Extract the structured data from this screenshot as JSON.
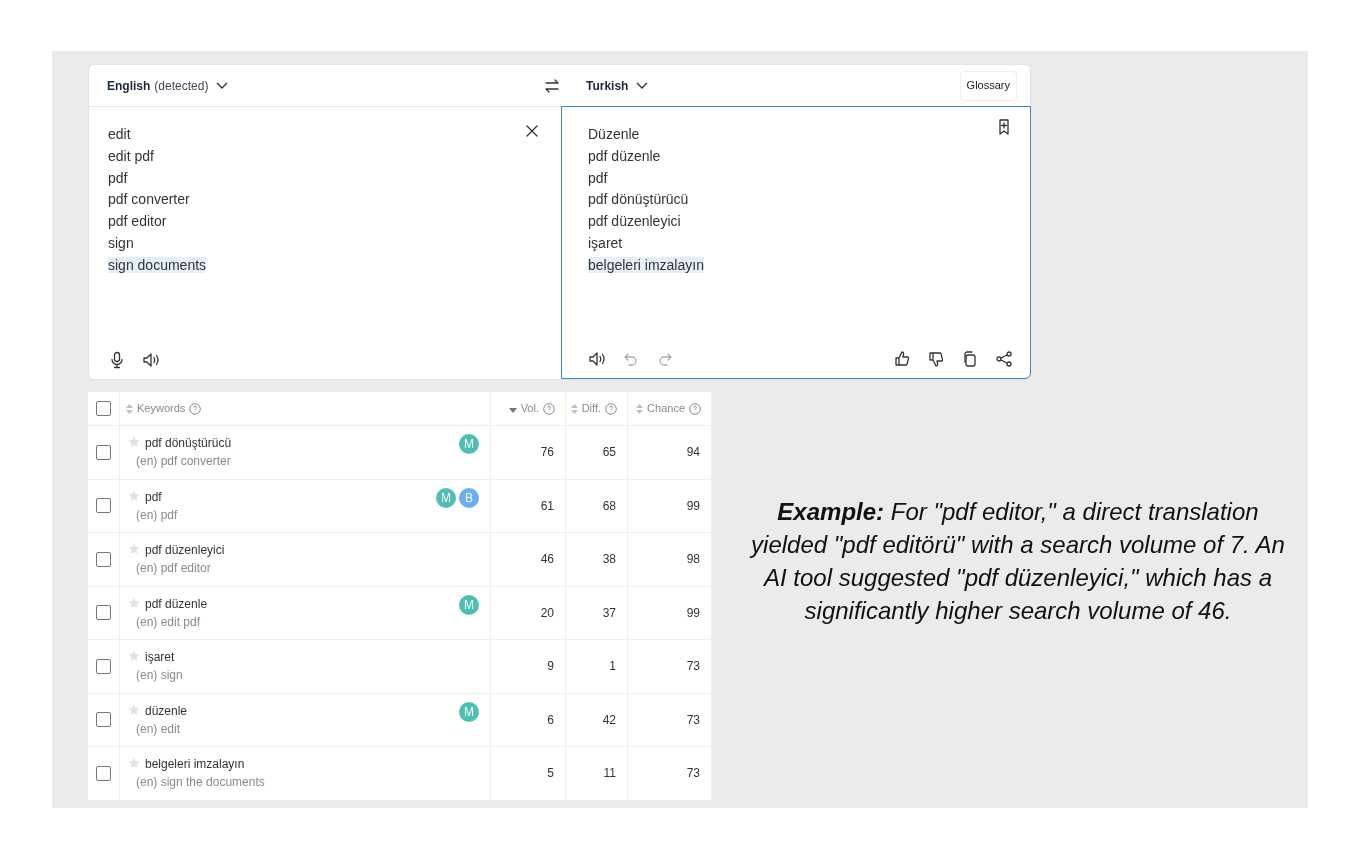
{
  "translator": {
    "source_language": {
      "name": "English",
      "note": "(detected)"
    },
    "target_language": {
      "name": "Turkish"
    },
    "glossary_button": "Glossary",
    "source_lines": [
      {
        "text": "edit",
        "highlighted": false
      },
      {
        "text": "edit pdf",
        "highlighted": false
      },
      {
        "text": "pdf",
        "highlighted": false
      },
      {
        "text": "pdf converter",
        "highlighted": false
      },
      {
        "text": "pdf editor",
        "highlighted": false
      },
      {
        "text": "sign",
        "highlighted": false
      },
      {
        "text": "sign documents",
        "highlighted": true
      }
    ],
    "target_lines": [
      {
        "text": "Düzenle",
        "highlighted": false
      },
      {
        "text": "pdf düzenle",
        "highlighted": false
      },
      {
        "text": "pdf",
        "highlighted": false
      },
      {
        "text": "pdf dönüştürücü",
        "highlighted": false
      },
      {
        "text": "pdf düzenleyici",
        "highlighted": false
      },
      {
        "text": "işaret",
        "highlighted": false
      },
      {
        "text": "belgeleri imzalayın",
        "highlighted": true
      }
    ]
  },
  "table": {
    "header_checked": false,
    "columns": [
      {
        "label": "Keywords",
        "sorted": false
      },
      {
        "label": "Vol.",
        "sorted": true
      },
      {
        "label": "Diff.",
        "sorted": false
      },
      {
        "label": "Chance",
        "sorted": false
      }
    ],
    "rows": [
      {
        "checked": false,
        "keyword": "pdf dönüştürücü",
        "source": "(en) pdf converter",
        "tags": [
          {
            "letter": "M",
            "color": "#4fbfb3"
          }
        ],
        "vol": "76",
        "diff": "65",
        "chance": "94"
      },
      {
        "checked": false,
        "keyword": "pdf",
        "source": "(en) pdf",
        "tags": [
          {
            "letter": "M",
            "color": "#4fbfb3"
          },
          {
            "letter": "B",
            "color": "#6aaef0"
          }
        ],
        "vol": "61",
        "diff": "68",
        "chance": "99"
      },
      {
        "checked": false,
        "keyword": "pdf düzenleyici",
        "source": "(en) pdf editor",
        "tags": [],
        "vol": "46",
        "diff": "38",
        "chance": "98"
      },
      {
        "checked": false,
        "keyword": "pdf düzenle",
        "source": "(en) edit pdf",
        "tags": [
          {
            "letter": "M",
            "color": "#4fbfb3"
          }
        ],
        "vol": "20",
        "diff": "37",
        "chance": "99"
      },
      {
        "checked": false,
        "keyword": "işaret",
        "source": "(en) sign",
        "tags": [],
        "vol": "9",
        "diff": "1",
        "chance": "73"
      },
      {
        "checked": false,
        "keyword": "düzenle",
        "source": "(en) edit",
        "tags": [
          {
            "letter": "M",
            "color": "#4fbfb3"
          }
        ],
        "vol": "6",
        "diff": "42",
        "chance": "73"
      },
      {
        "checked": false,
        "keyword": "belgeleri imzalayın",
        "source": "(en) sign the documents",
        "tags": [],
        "vol": "5",
        "diff": "11",
        "chance": "73"
      }
    ]
  },
  "caption": "**Example:** For \"pdf editor,\" a direct translation yielded \"pdf editörü\" with a search volume of 7. An AI tool suggested \"pdf düzenleyici,\" which has a significantly higher search volume of 46."
}
